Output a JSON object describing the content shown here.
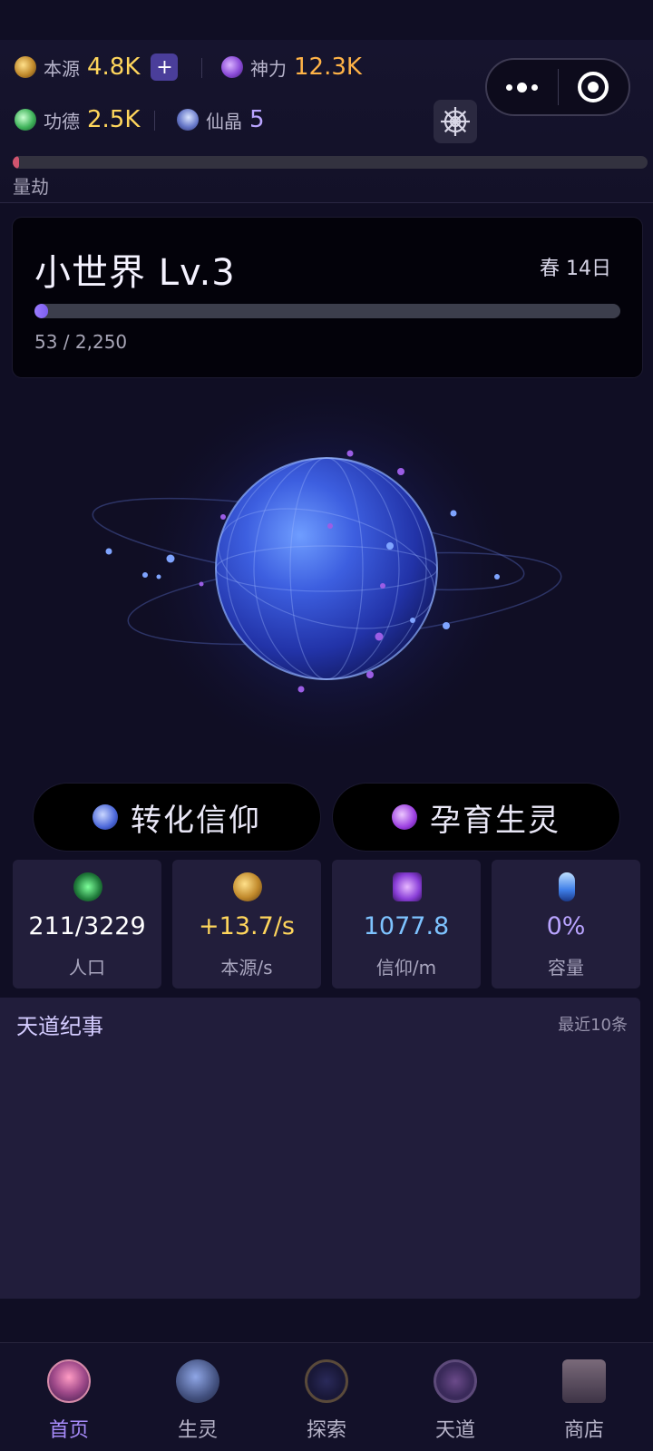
{
  "resources": {
    "benyuan": {
      "label": "本源",
      "value": "4.8K",
      "icon": "benyuan-icon",
      "color": "#ffd65c"
    },
    "shenli": {
      "label": "神力",
      "value": "12.3K",
      "icon": "shenli-icon",
      "color": "#ffb347"
    },
    "gongde": {
      "label": "功德",
      "value": "2.5K",
      "icon": "gongde-icon",
      "color": "#ffd65c"
    },
    "xianjing": {
      "label": "仙晶",
      "value": "5",
      "icon": "xianjing-icon",
      "color": "#b9a4ff"
    },
    "plus_label": "+"
  },
  "catastrophe": {
    "label": "量劫",
    "progress": 0.01
  },
  "world": {
    "title": "小世界 Lv.3",
    "date": "春 14日",
    "xp_text": "53 / 2,250",
    "progress": 0.0236
  },
  "actions": [
    {
      "label": "转化信仰",
      "icon": "faith-orb-icon"
    },
    {
      "label": "孕育生灵",
      "icon": "spirit-orb-icon"
    }
  ],
  "stats": [
    {
      "value": "211/3229",
      "label": "人口",
      "icon": "population-icon",
      "color": "#ffffff"
    },
    {
      "value": "+13.7/s",
      "label": "本源/s",
      "icon": "benyuan-rate-icon",
      "color": "#ffd65c"
    },
    {
      "value": "1077.8",
      "label": "信仰/m",
      "icon": "faith-icon",
      "color": "#7ec3ff"
    },
    {
      "value": "0%",
      "label": "容量",
      "icon": "capacity-icon",
      "color": "#b9a4ff"
    }
  ],
  "chronicle": {
    "title": "天道纪事",
    "subtitle": "最近10条"
  },
  "tabs": [
    {
      "label": "首页",
      "icon": "home-icon",
      "active": true
    },
    {
      "label": "生灵",
      "icon": "dragon-icon",
      "active": false
    },
    {
      "label": "探索",
      "icon": "compass-icon",
      "active": false
    },
    {
      "label": "天道",
      "icon": "taiji-icon",
      "active": false
    },
    {
      "label": "商店",
      "icon": "treasure-chest-icon",
      "active": false
    }
  ],
  "colors": {
    "accent": "#a78bfa",
    "background": "#100e24",
    "card": "#221e3b"
  }
}
